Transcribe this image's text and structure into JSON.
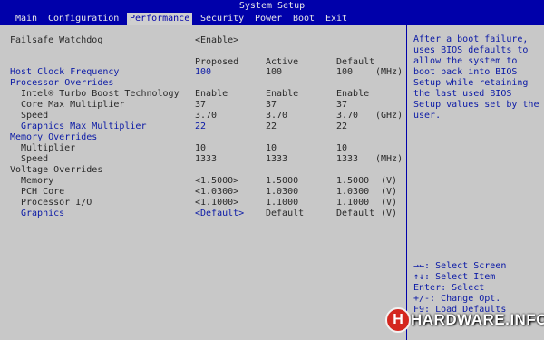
{
  "title": "System Setup",
  "menu": {
    "items": [
      "Main",
      "Configuration",
      "Performance",
      "Security",
      "Power",
      "Boot",
      "Exit"
    ],
    "active": "Performance"
  },
  "failsafe": {
    "label": "Failsafe Watchdog",
    "value": "<Enable>"
  },
  "columns": {
    "proposed": "Proposed",
    "active": "Active",
    "default": "Default"
  },
  "rows": [
    {
      "label": "Host Clock Frequency",
      "proposed": "100",
      "active": "100",
      "default": "100",
      "unit": "(MHz)"
    },
    {
      "label": "Processor Overrides"
    },
    {
      "label": "Intel® Turbo Boost Technology",
      "proposed": "Enable",
      "active": "Enable",
      "default": "Enable",
      "unit": ""
    },
    {
      "label": "Core Max Multiplier",
      "proposed": "37",
      "active": "37",
      "default": "37",
      "unit": ""
    },
    {
      "label": "Speed",
      "proposed": "3.70",
      "active": "3.70",
      "default": "3.70",
      "unit": "(GHz)"
    },
    {
      "label": "Graphics Max Multiplier",
      "proposed": "22",
      "active": "22",
      "default": "22",
      "unit": ""
    },
    {
      "label": "Memory Overrides"
    },
    {
      "label": "Multiplier",
      "proposed": "10",
      "active": "10",
      "default": "10",
      "unit": ""
    },
    {
      "label": "Speed",
      "proposed": "1333",
      "active": "1333",
      "default": "1333",
      "unit": "(MHz)"
    },
    {
      "label": "Voltage Overrides"
    },
    {
      "label": "Memory",
      "proposed": "<1.5000>",
      "active": "1.5000",
      "default": "1.5000",
      "unit": "(V)"
    },
    {
      "label": "PCH Core",
      "proposed": "<1.0300>",
      "active": "1.0300",
      "default": "1.0300",
      "unit": "(V)"
    },
    {
      "label": "Processor I/O",
      "proposed": "<1.1000>",
      "active": "1.1000",
      "default": "1.1000",
      "unit": "(V)"
    },
    {
      "label": "Graphics",
      "proposed": "<Default>",
      "active": "Default",
      "default": "Default",
      "unit": "(V)"
    }
  ],
  "help_text": "After a boot failure, uses BIOS defaults to allow the system to boot back into BIOS Setup while retaining the last used BIOS Setup values set by the user.",
  "keys": [
    "→←: Select Screen",
    "↑↓: Select Item",
    "Enter: Select",
    "+/-: Change Opt.",
    "F9: Load Defaults"
  ],
  "logo": {
    "letter": "H",
    "text": "HARDWARE.INFO"
  },
  "colors": {
    "accent": "#0000aa",
    "background": "#c8c8c8",
    "text_blue": "#0b1aa6",
    "text_dark": "#2a2a2a",
    "logo_red": "#d4261e"
  }
}
